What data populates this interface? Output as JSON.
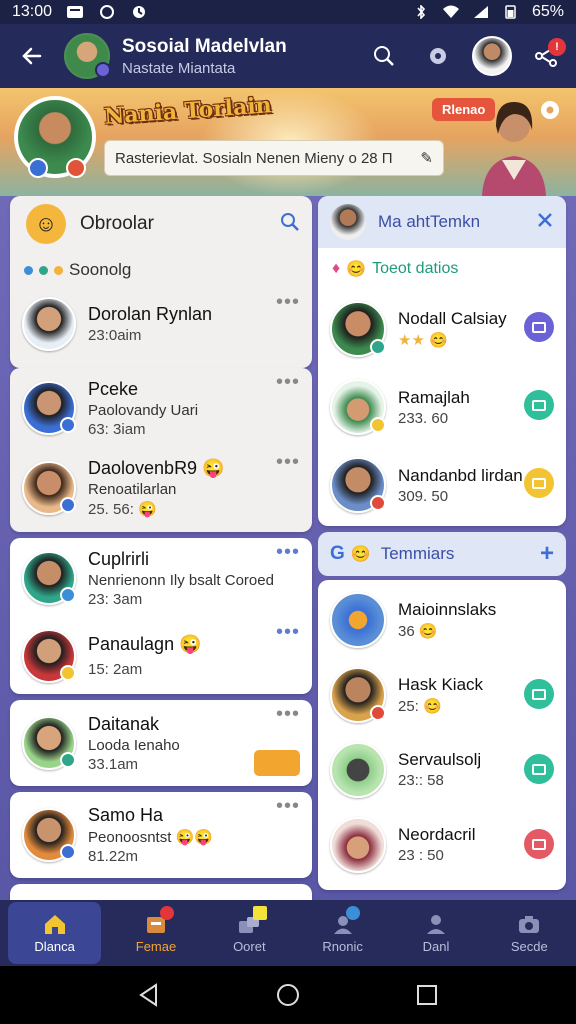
{
  "status_bar": {
    "time": "13:00",
    "battery": "65%"
  },
  "header": {
    "title": "Sosoial Madelvlan",
    "subtitle": "Nastate Miantata"
  },
  "banner": {
    "logo_text": "Nania Torlain",
    "status_text": "Rasterievlat. Sosialn Nenen Mieny o 28 Π",
    "tag": "Rlenao"
  },
  "chats": {
    "title": "Obroolar",
    "filter_label": "Soonolg",
    "items": [
      {
        "name": "Dorolan Rynlan",
        "sub": "",
        "time": "23:0aim"
      },
      {
        "name": "Pceke",
        "sub": "Paolovandy Uari",
        "time": "63: 3iam"
      },
      {
        "name": "DaolovenbR9",
        "sub": "Renoatilarlan",
        "time": "25. 56:"
      },
      {
        "name": "Cuplrirli",
        "sub": "Nenrienonn Ily bsalt Coroed",
        "time": "23: 3am"
      },
      {
        "name": "Panaulagn",
        "sub": "",
        "time": "15: 2am"
      },
      {
        "name": "Daitanak",
        "sub": "Looda Ienaho",
        "time": "33.1am"
      },
      {
        "name": "Samo Ha",
        "sub": "Peonoosntst",
        "time": "81.22m"
      }
    ]
  },
  "favorites": {
    "title": "Ma ahtTemkn",
    "subtitle": "Toeot datios",
    "items": [
      {
        "name": "Nodall Calsiay",
        "time": ""
      },
      {
        "name": "Ramajlah",
        "time": "233. 60"
      },
      {
        "name": "Nandanbd lirdan",
        "time": "309. 50"
      }
    ]
  },
  "teams": {
    "title": "Temmiars",
    "items": [
      {
        "name": "Maioinnslaks",
        "time": "36"
      },
      {
        "name": "Hask Kiack",
        "time": "25:"
      },
      {
        "name": "Servaulsolj",
        "time": "23:: 58"
      },
      {
        "name": "Neordacril",
        "time": "23 : 50"
      }
    ]
  },
  "bottom_nav": [
    {
      "label": "Dlanca",
      "icon": "home-icon"
    },
    {
      "label": "Femae",
      "icon": "inbox-icon"
    },
    {
      "label": "Ooret",
      "icon": "groups-icon"
    },
    {
      "label": "Rnonic",
      "icon": "contacts-icon"
    },
    {
      "label": "Danl",
      "icon": "person-icon"
    },
    {
      "label": "Secde",
      "icon": "camera-icon"
    }
  ],
  "colors": {
    "accent": "#3b4694",
    "header_bg": "#242a5a",
    "badge_red": "#e2363a"
  }
}
